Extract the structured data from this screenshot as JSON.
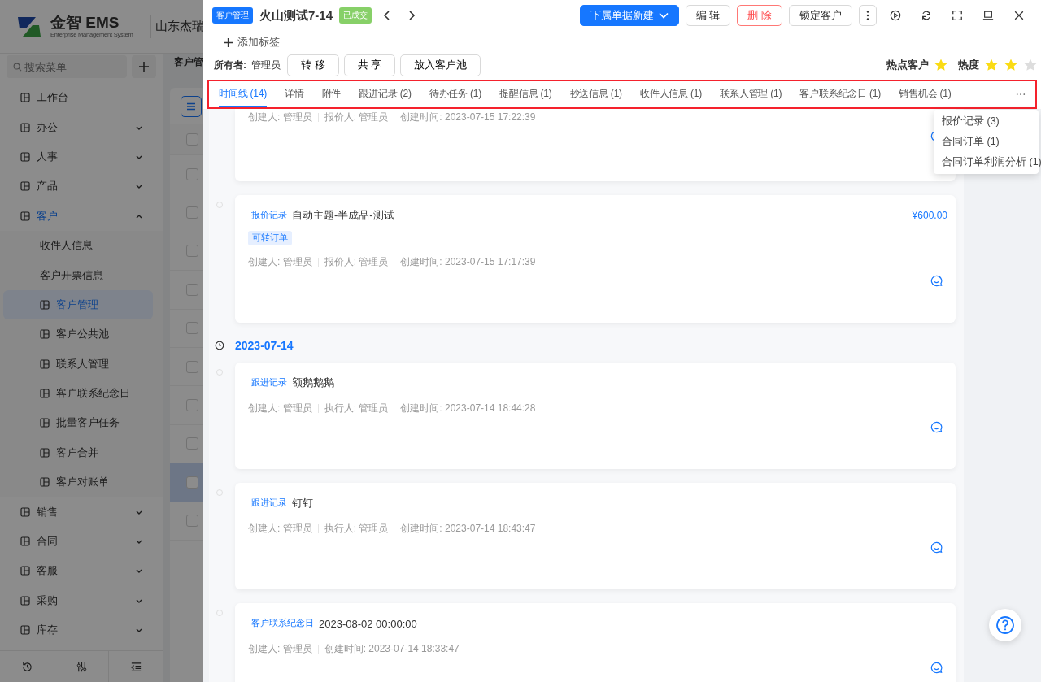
{
  "app": {
    "logo_title": "金智 EMS",
    "logo_subtitle": "Enterprise Management System",
    "company": "山东杰瑞",
    "search": {
      "placeholder": "搜索菜单"
    },
    "menu": [
      {
        "label": "工作台",
        "selected": false
      },
      {
        "label": "办公",
        "selected": false,
        "expanded": false
      },
      {
        "label": "人事",
        "selected": false,
        "expanded": false
      },
      {
        "label": "产品",
        "selected": false,
        "expanded": false
      },
      {
        "label": "客户",
        "selected": true,
        "expanded": true,
        "children": [
          {
            "label": "收件人信息",
            "selected": false
          },
          {
            "label": "客户开票信息",
            "selected": false
          },
          {
            "label": "客户管理",
            "selected": true
          },
          {
            "label": "客户公共池",
            "selected": false
          },
          {
            "label": "联系人管理",
            "selected": false
          },
          {
            "label": "客户联系纪念日",
            "selected": false
          },
          {
            "label": "批量客户任务",
            "selected": false
          },
          {
            "label": "客户合并",
            "selected": false
          },
          {
            "label": "客户对账单",
            "selected": false
          }
        ]
      },
      {
        "label": "销售",
        "selected": false,
        "expanded": false
      },
      {
        "label": "合同",
        "selected": false,
        "expanded": false
      },
      {
        "label": "客服",
        "selected": false,
        "expanded": false
      },
      {
        "label": "采购",
        "selected": false,
        "expanded": false
      },
      {
        "label": "库存",
        "selected": false,
        "expanded": false
      }
    ],
    "page_title": "客户管",
    "header_checked": false,
    "rows": [
      {
        "checked": false,
        "selected": false
      },
      {
        "checked": false,
        "selected": false
      },
      {
        "checked": false,
        "selected": false
      },
      {
        "checked": false,
        "selected": false
      },
      {
        "checked": false,
        "selected": false
      },
      {
        "checked": false,
        "selected": false
      },
      {
        "checked": false,
        "selected": false
      },
      {
        "checked": false,
        "selected": false
      },
      {
        "checked": false,
        "selected": true
      },
      {
        "checked": false,
        "selected": false
      }
    ]
  },
  "drawer": {
    "module_badge": "客户管理",
    "title": "火山测试7-14",
    "status": "已成交",
    "actions": [
      {
        "label": "下属单据新建",
        "kind": "primary"
      },
      {
        "label": "编 辑",
        "kind": "default"
      },
      {
        "label": "删 除",
        "kind": "danger"
      },
      {
        "label": "锁定客户",
        "kind": "default"
      }
    ],
    "add_tag": "添加标签",
    "owner_label": "所有者:",
    "owner": "管理员",
    "owner_actions": [
      "转 移",
      "共 享",
      "放入客户池"
    ],
    "hot_label": "热点客户",
    "hot": true,
    "heat_label": "热度",
    "heat": {
      "stars": 2
    },
    "tabs": [
      {
        "label": "时间线 (14)",
        "selected": true
      },
      {
        "label": "详情",
        "selected": false
      },
      {
        "label": "附件",
        "selected": false
      },
      {
        "label": "跟进记录 (2)",
        "selected": false
      },
      {
        "label": "待办任务 (1)",
        "selected": false
      },
      {
        "label": "提醒信息 (1)",
        "selected": false
      },
      {
        "label": "抄送信息 (1)",
        "selected": false
      },
      {
        "label": "收件人信息 (1)",
        "selected": false
      },
      {
        "label": "联系人管理 (1)",
        "selected": false
      },
      {
        "label": "客户联系纪念日 (1)",
        "selected": false
      },
      {
        "label": "销售机会 (1)",
        "selected": false
      }
    ],
    "more_menu": [
      "报价记录 (3)",
      "合同订单 (1)",
      "合同订单利润分析 (1)"
    ],
    "timeline": [
      {
        "kind": "card",
        "meta": [
          "创建人: 管理员",
          "报价人: 管理员",
          "创建时间: 2023-07-15 17:22:39"
        ]
      },
      {
        "kind": "card",
        "tag": "报价记录",
        "title": "自动主题-半成品-测试",
        "amount": "¥600.00",
        "badge": "可转订单",
        "meta": [
          "创建人: 管理员",
          "报价人: 管理员",
          "创建时间: 2023-07-15 17:17:39"
        ]
      },
      {
        "kind": "date",
        "date": "2023-07-14"
      },
      {
        "kind": "card",
        "tag": "跟进记录",
        "title": "额鹅鹅鹅",
        "meta": [
          "创建人: 管理员",
          "执行人: 管理员",
          "创建时间: 2023-07-14 18:44:28"
        ]
      },
      {
        "kind": "card",
        "tag": "跟进记录",
        "title": "钉钉",
        "meta": [
          "创建人: 管理员",
          "执行人: 管理员",
          "创建时间: 2023-07-14 18:43:47"
        ]
      },
      {
        "kind": "card",
        "tag": "客户联系纪念日",
        "title": "2023-08-02 00:00:00",
        "meta": [
          "创建人: 管理员",
          "创建时间: 2023-07-14 18:33:47"
        ]
      }
    ]
  }
}
